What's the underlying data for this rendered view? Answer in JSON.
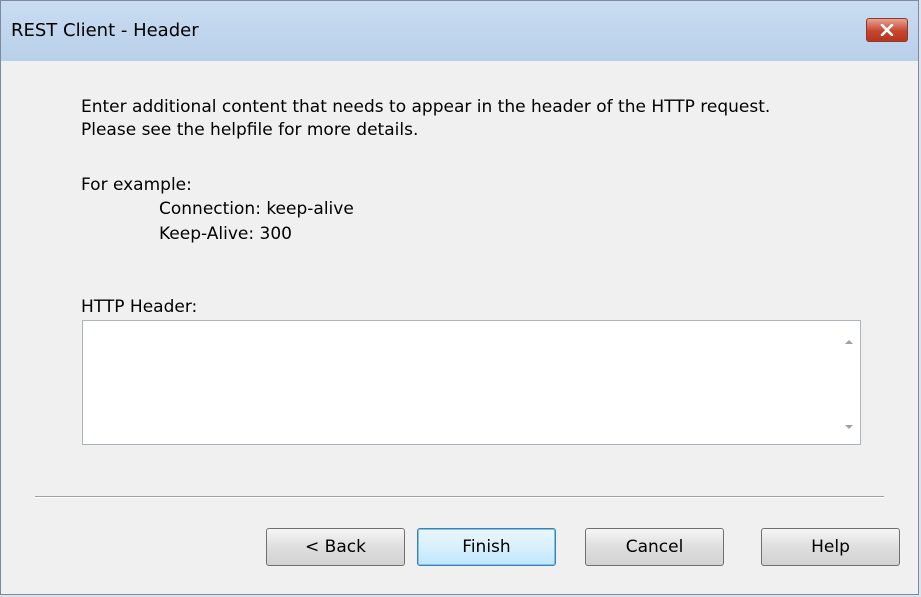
{
  "window": {
    "title": "REST Client - Header"
  },
  "content": {
    "description": "Enter additional content that needs to appear in the header of the HTTP request. Please see the helpfile for more details.",
    "example_label": "For example:",
    "example_lines": [
      "Connection: keep-alive",
      "Keep-Alive: 300"
    ],
    "http_header_label": "HTTP Header:",
    "http_header_value": ""
  },
  "buttons": {
    "back": "< Back",
    "finish": "Finish",
    "cancel": "Cancel",
    "help": "Help"
  },
  "icons": {
    "close": "close-icon",
    "scroll_up": "scroll-up-arrow-icon",
    "scroll_down": "scroll-down-arrow-icon"
  }
}
